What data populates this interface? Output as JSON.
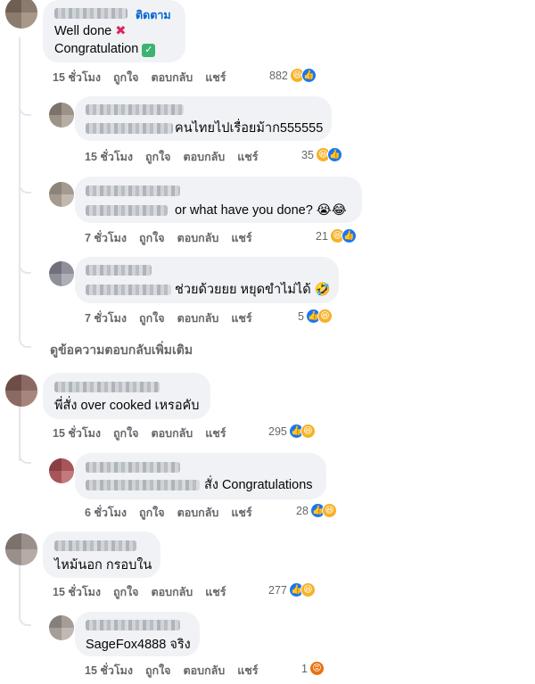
{
  "ui": {
    "like": "ถูกใจ",
    "reply": "ตอบกลับ",
    "share": "แชร์",
    "follow": "ติดตาม"
  },
  "comments": [
    {
      "time": "15 ชั่วโมง",
      "count": "882",
      "line1": "Well done",
      "line2": "Congratulation",
      "reactions": [
        "haha",
        "like"
      ]
    },
    {
      "time": "15 ชั่วโมง",
      "count": "35",
      "text": "คนไทยไปเรื่อยม้าก555555",
      "reactions": [
        "haha",
        "like"
      ]
    },
    {
      "time": "7 ชั่วโมง",
      "count": "21",
      "text": "or what have you done? 😭😂",
      "reactions": [
        "haha",
        "like"
      ]
    },
    {
      "time": "7 ชั่วโมง",
      "count": "5",
      "text": "ช่วยด้วยยย หยุดขำไม่ได้ 🤣",
      "reactions": [
        "like",
        "haha"
      ]
    },
    {
      "time": "15 ชั่วโมง",
      "count": "295",
      "text": "พี่สั่ง over cooked เหรอคับ",
      "reactions": [
        "like",
        "haha"
      ]
    },
    {
      "time": "6 ชั่วโมง",
      "count": "28",
      "text": "สั่ง Congratulations",
      "reactions": [
        "like",
        "haha"
      ]
    },
    {
      "time": "15 ชั่วโมง",
      "count": "277",
      "text": "ไหม้นอก กรอบใน",
      "reactions": [
        "like",
        "haha"
      ]
    },
    {
      "time": "15 ชั่วโมง",
      "count": "1",
      "text": "SageFox4888 จริง",
      "reactions": [
        "angry"
      ]
    }
  ],
  "see_more_replies": "ดูข้อความตอบกลับเพิ่มเติม"
}
